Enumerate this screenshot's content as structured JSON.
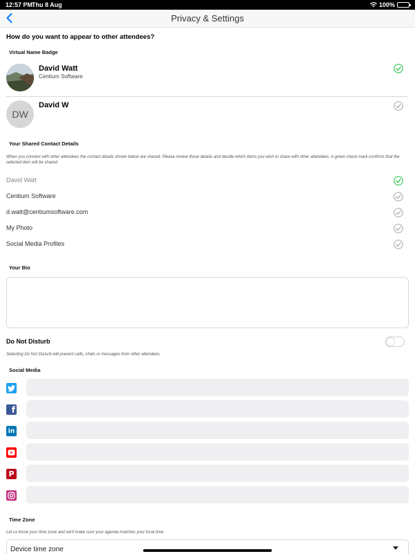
{
  "status_bar": {
    "time": "12:57 PM",
    "date": "Thu 8 Aug",
    "battery": "100%"
  },
  "nav": {
    "title": "Privacy & Settings",
    "back_icon": "chevron-left-icon"
  },
  "appearance": {
    "question": "How do you want to appear to other attendees?",
    "section_label": "Virtual Name Badge",
    "badges": [
      {
        "name": "David Watt",
        "company": "Centium Software",
        "selected": true
      },
      {
        "name": "David W",
        "initials": "DW",
        "selected": false
      }
    ]
  },
  "contact": {
    "section_label": "Your Shared Contact Details",
    "info": "When you connect with other attendees the contact details shown below are shared. Please review these details and decide which items you wish to share with other attendees. A green check mark confirms that the selected item will be shared.",
    "items": [
      {
        "label": "David Watt",
        "selected": true
      },
      {
        "label": "Centium Software",
        "selected": false
      },
      {
        "label": "d.watt@centiumsoftware.com",
        "selected": false
      },
      {
        "label": "My Photo",
        "selected": false
      },
      {
        "label": "Social Media Profiles",
        "selected": false
      }
    ]
  },
  "bio": {
    "section_label": "Your Bio",
    "value": ""
  },
  "dnd": {
    "label": "Do Not Disturb",
    "enabled": false,
    "info": "Selecting Do Not Disturb will prevent calls, chats or messages from other attendees."
  },
  "social": {
    "section_label": "Social Media",
    "networks": [
      {
        "icon": "twitter-icon",
        "color": "#1DA1F2",
        "value": ""
      },
      {
        "icon": "facebook-icon",
        "color": "#3B5998",
        "value": ""
      },
      {
        "icon": "linkedin-icon",
        "color": "#0077B5",
        "value": ""
      },
      {
        "icon": "youtube-icon",
        "color": "#FF0000",
        "value": ""
      },
      {
        "icon": "pinterest-icon",
        "color": "#BD081C",
        "value": ""
      },
      {
        "icon": "instagram-icon",
        "color": "#C13584",
        "value": ""
      }
    ]
  },
  "timezone": {
    "section_label": "Time Zone",
    "info": "Let us know your time zone and we'll make sure your agenda matches your local time.",
    "value": "Device time zone"
  },
  "colors": {
    "accent_blue": "#007AFF",
    "check_green": "#34C759",
    "check_grey": "#B0B0B0"
  }
}
